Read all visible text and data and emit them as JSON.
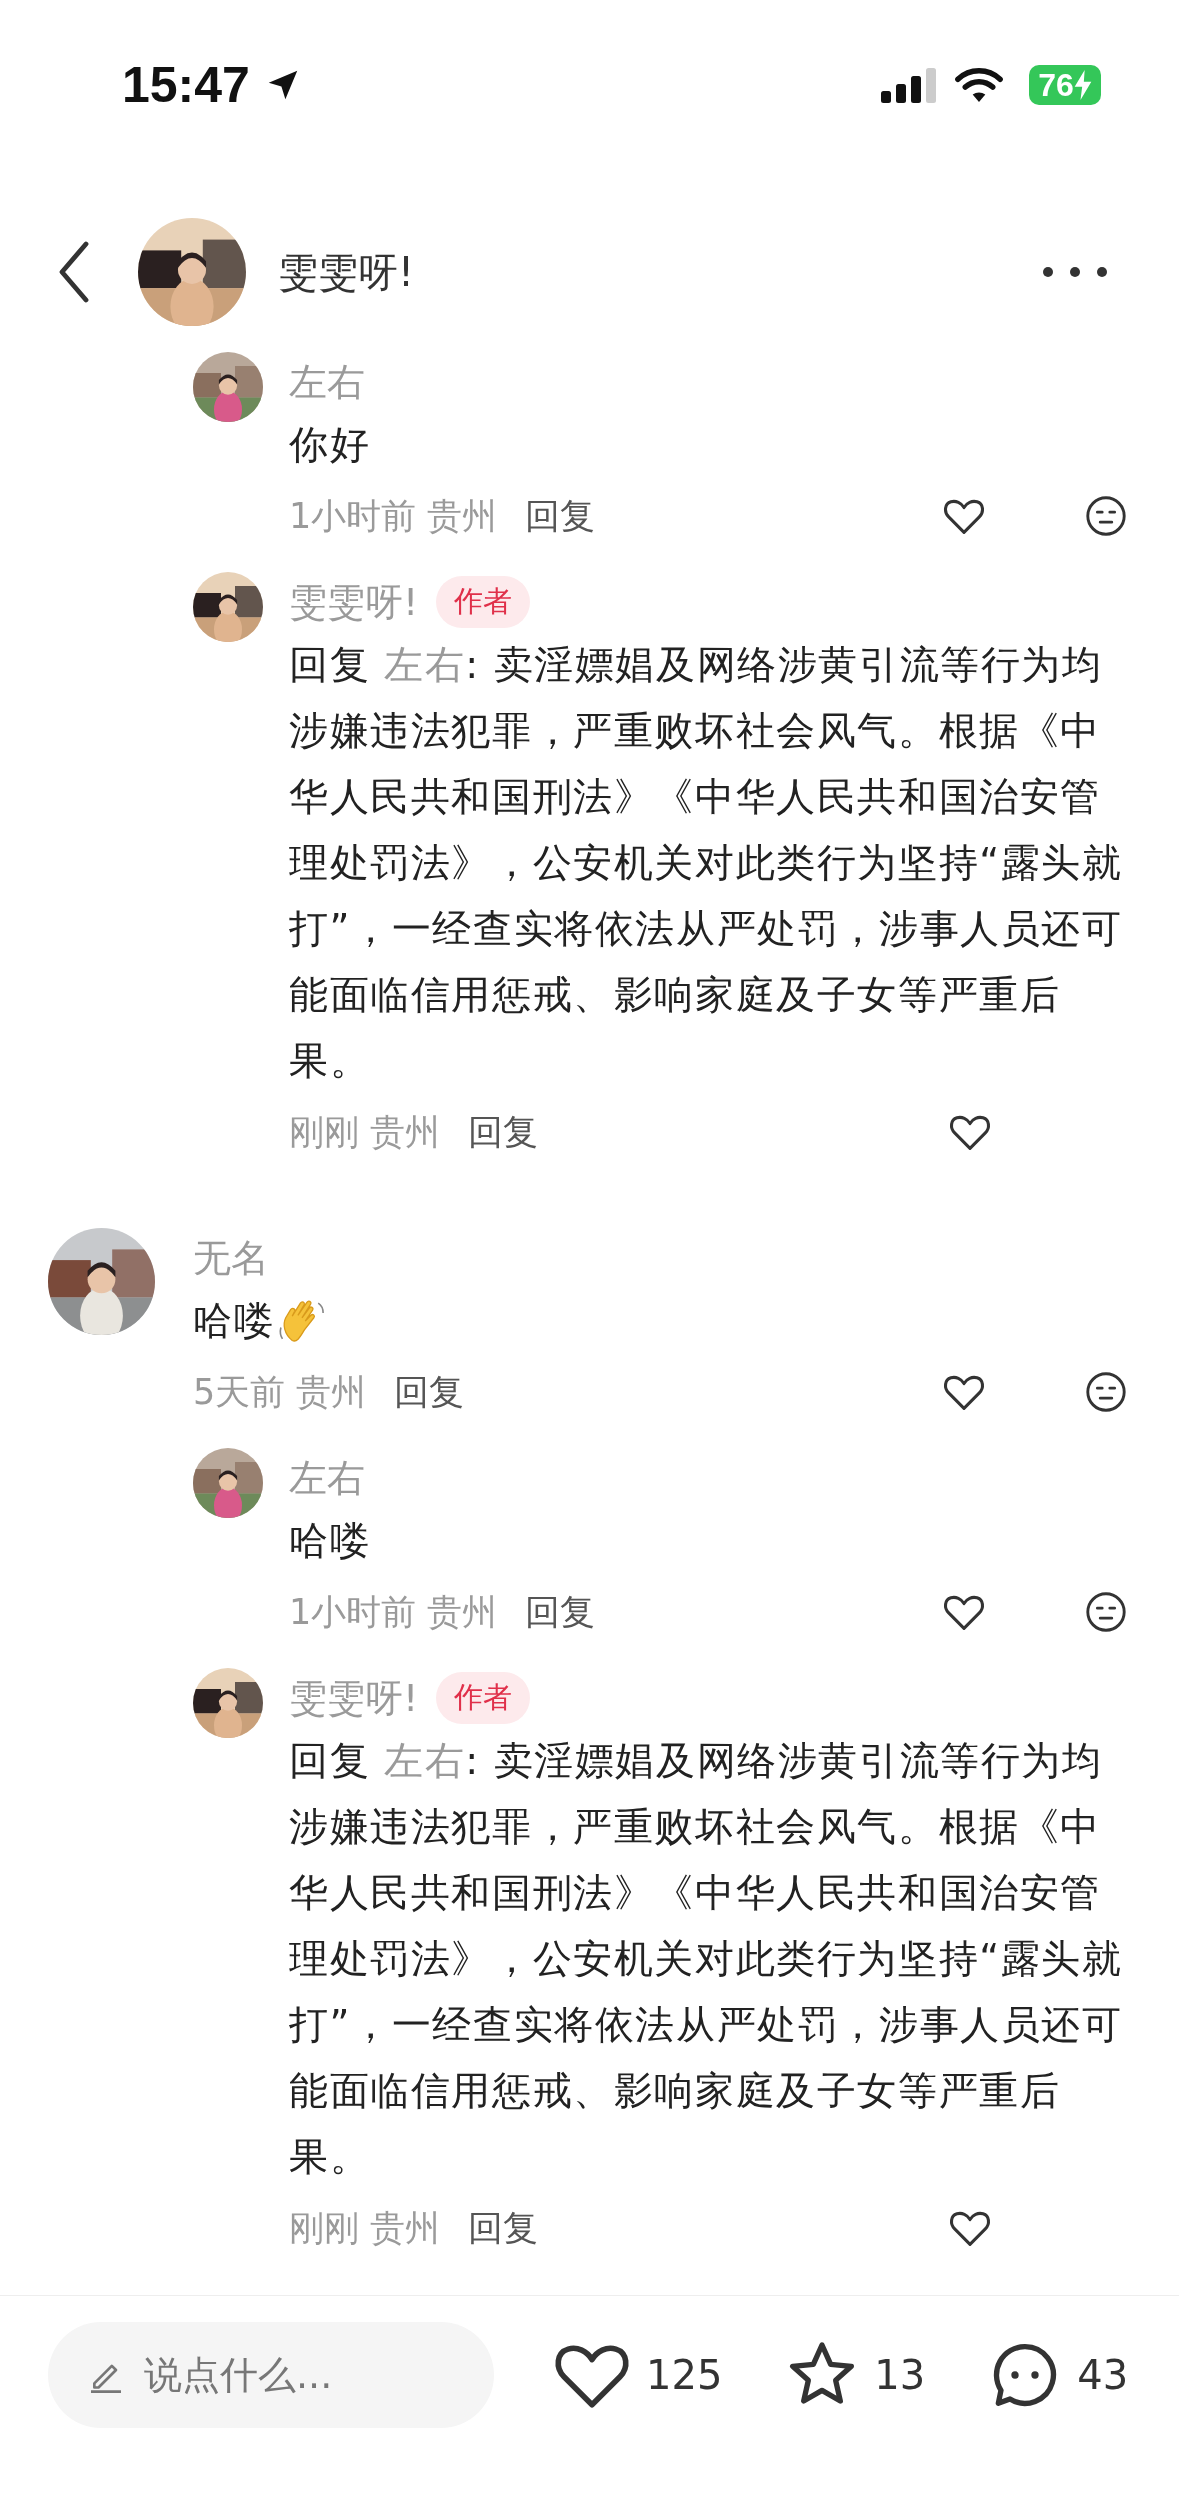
{
  "status_bar": {
    "time": "15:47",
    "battery": "76"
  },
  "header": {
    "name": "雯雯呀!"
  },
  "replies_of_offscreen_comment": [
    {
      "name": "左右",
      "body": {
        "kind": "plain",
        "text": "你好"
      },
      "time": "1小时前",
      "location": "贵州",
      "reply_label": "回复",
      "dislike_button": true
    },
    {
      "name": "雯雯呀!",
      "author_badge": "作者",
      "body": {
        "kind": "reply",
        "prefix": "回复",
        "target": "左右",
        "text": ": 卖淫嫖娼及网络涉黄引流等行为均涉嫌违法犯罪，严重败坏社会风气。根据《中华人民共和国刑法》《中华人民共和国治安管理处罚法》，公安机关对此类行为坚持“露头就打”，一经查实将依法从严处罚，涉事人员还可能面临信用惩戒、影响家庭及子女等严重后果。"
      },
      "time": "刚刚",
      "location": "贵州",
      "reply_label": "回复",
      "dislike_button": false
    }
  ],
  "comments": [
    {
      "name": "无名",
      "body": {
        "kind": "plain",
        "text": "哈喽",
        "wave_emoji": true
      },
      "time": "5天前",
      "location": "贵州",
      "reply_label": "回复",
      "dislike_button": true,
      "children": [
        {
          "name": "左右",
          "body": {
            "kind": "plain",
            "text": "哈喽"
          },
          "time": "1小时前",
          "location": "贵州",
          "reply_label": "回复",
          "dislike_button": true
        },
        {
          "name": "雯雯呀!",
          "author_badge": "作者",
          "body": {
            "kind": "reply",
            "prefix": "回复",
            "target": "左右",
            "text": ": 卖淫嫖娼及网络涉黄引流等行为均涉嫌违法犯罪，严重败坏社会风气。根据《中华人民共和国刑法》《中华人民共和国治安管理处罚法》，公安机关对此类行为坚持“露头就打”，一经查实将依法从严处罚，涉事人员还可能面临信用惩戒、影响家庭及子女等严重后果。"
          },
          "time": "刚刚",
          "location": "贵州",
          "reply_label": "回复",
          "dislike_button": false
        }
      ]
    }
  ],
  "bottom_bar": {
    "placeholder": "说点什么...",
    "likes": "125",
    "favorites": "13",
    "comments": "43"
  }
}
